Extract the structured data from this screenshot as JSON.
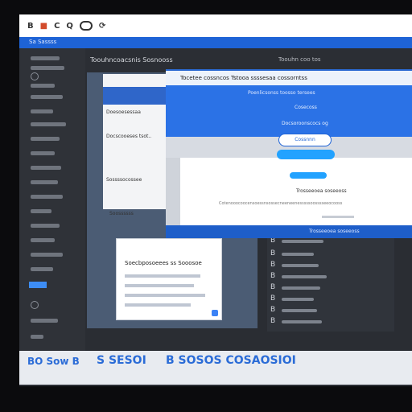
{
  "toolbar": {
    "b_label": "B",
    "c_label": "C",
    "q_label": "Q"
  },
  "app": {
    "sidebar_header": "Sa Sassss",
    "header_title": "Toouhncoacsnis Sosnooss",
    "header_right": "Toouhn coo tos"
  },
  "dialog": {
    "title": "Tocetee cossncos Tstooa ssssesaa cossorntss",
    "line1": "Poenlicsonss toosso tersees",
    "line2": "Cosecoss",
    "line3": "Docsoroonscocs og",
    "primary_button": "Cossnnn",
    "footer_text": "Trosseeoea soseeoss",
    "body_line": "Cotenooocoocensoessnsossecneeneenesssssoosssseeocooss"
  },
  "panel": {
    "row1": "Doesoesessaa",
    "row2": "Docscooeses tsot..",
    "row3": "Sossssocossee",
    "row4": "Soossssss"
  },
  "bubble": {
    "title": "Soecbposoeees ss Sooosoe"
  },
  "list": {
    "markers": [
      "B",
      "B",
      "B",
      "B",
      "B",
      "B",
      "B",
      "B"
    ]
  },
  "taskbar": {
    "left_text": "BO Sow B",
    "mid_text": "S SESOI",
    "right_text": "B SOSOS COSAOSIOI"
  }
}
